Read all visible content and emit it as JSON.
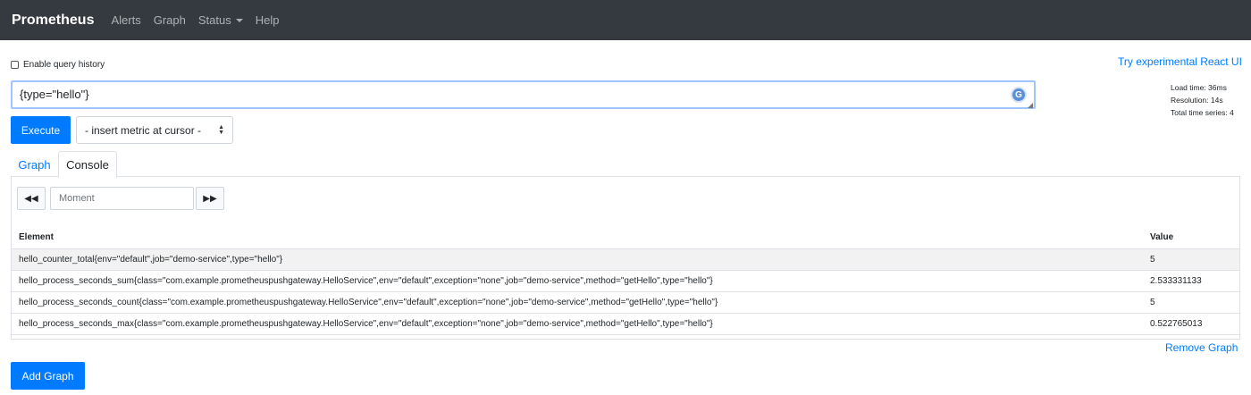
{
  "navbar": {
    "brand": "Prometheus",
    "links": [
      "Alerts",
      "Graph",
      "Status",
      "Help"
    ]
  },
  "query_history_label": "Enable query history",
  "react_ui_link": "Try experimental React UI",
  "expression": {
    "value": "{type=\"hello\"}"
  },
  "stats": {
    "load_time": "Load time: 36ms",
    "resolution": "Resolution: 14s",
    "total_series": "Total time series: 4"
  },
  "execute_label": "Execute",
  "metric_select_label": "- insert metric at cursor -",
  "tabs": [
    "Graph",
    "Console"
  ],
  "console": {
    "moment_placeholder": "Moment",
    "back_icon": "fast-backward-icon",
    "forward_icon": "fast-forward-icon",
    "columns": [
      "Element",
      "Value"
    ],
    "rows": [
      {
        "element": "hello_counter_total{env=\"default\",job=\"demo-service\",type=\"hello\"}",
        "value": "5"
      },
      {
        "element": "hello_process_seconds_sum{class=\"com.example.prometheuspushgateway.HelloService\",env=\"default\",exception=\"none\",job=\"demo-service\",method=\"getHello\",type=\"hello\"}",
        "value": "2.533331133"
      },
      {
        "element": "hello_process_seconds_count{class=\"com.example.prometheuspushgateway.HelloService\",env=\"default\",exception=\"none\",job=\"demo-service\",method=\"getHello\",type=\"hello\"}",
        "value": "5"
      },
      {
        "element": "hello_process_seconds_max{class=\"com.example.prometheuspushgateway.HelloService\",env=\"default\",exception=\"none\",job=\"demo-service\",method=\"getHello\",type=\"hello\"}",
        "value": "0.522765013"
      }
    ]
  },
  "remove_graph_label": "Remove Graph",
  "add_graph_label": "Add Graph",
  "colors": {
    "navbar": "#343a40",
    "primary": "#007bff"
  }
}
